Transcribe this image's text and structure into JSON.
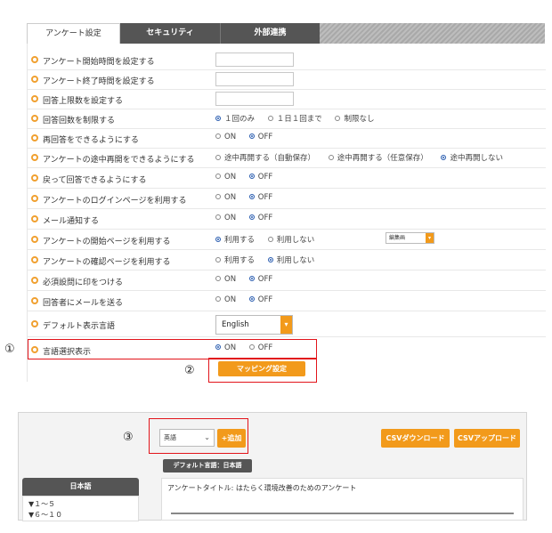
{
  "tabs": [
    {
      "label": "アンケート設定",
      "active": true
    },
    {
      "label": "セキュリティ",
      "active": false
    },
    {
      "label": "外部連携",
      "active": false
    }
  ],
  "settings": [
    {
      "label": "アンケート開始時間を設定する"
    },
    {
      "label": "アンケート終了時間を設定する"
    },
    {
      "label": "回答上限数を設定する"
    },
    {
      "label": "回答回数を制限する",
      "options": [
        "１回のみ",
        "１日１回まで",
        "制限なし"
      ],
      "selected": 0
    },
    {
      "label": "再回答をできるようにする",
      "options": [
        "ON",
        "OFF"
      ],
      "selected": 1
    },
    {
      "label": "アンケートの途中再開をできるようにする",
      "options": [
        "途中再開する（自動保存）",
        "途中再開する（任意保存）",
        "途中再開しない"
      ],
      "selected": 2
    },
    {
      "label": "戻って回答できるようにする",
      "options": [
        "ON",
        "OFF"
      ],
      "selected": 1
    },
    {
      "label": "アンケートのログインページを利用する",
      "options": [
        "ON",
        "OFF"
      ],
      "selected": 1
    },
    {
      "label": "メール通知する",
      "options": [
        "ON",
        "OFF"
      ],
      "selected": 1
    },
    {
      "label": "アンケートの開始ページを利用する",
      "options": [
        "利用する",
        "利用しない"
      ],
      "selected": 0,
      "select_value": "編集画"
    },
    {
      "label": "アンケートの確認ページを利用する",
      "options": [
        "利用する",
        "利用しない"
      ],
      "selected": 1
    },
    {
      "label": "必須設問に印をつける",
      "options": [
        "ON",
        "OFF"
      ],
      "selected": 1
    },
    {
      "label": "回答者にメールを送る",
      "options": [
        "ON",
        "OFF"
      ],
      "selected": 1
    },
    {
      "label": "デフォルト表示言語",
      "select_value": "English"
    },
    {
      "label": "言語選択表示",
      "options": [
        "ON",
        "OFF"
      ],
      "selected": 0
    }
  ],
  "mapping_button": "マッピング設定",
  "markers": [
    "①",
    "②",
    "③"
  ],
  "bottom": {
    "lang_select": "英語",
    "add_button": "+追加",
    "csv_download": "CSVダウンロード",
    "csv_upload": "CSVアップロード",
    "default_lang_tag": "デフォルト言語：日本語",
    "sidebar_title": "日本語",
    "sidebar_items": [
      "▼１～５",
      "▼６～１０"
    ],
    "survey_title_label": "アンケートタイトル: はたらく環境改善のためのアンケート"
  },
  "colors": {
    "accent": "#f29a1b",
    "highlight": "#e2141a",
    "radio_on": "#2a5db0",
    "dark": "#555555"
  }
}
